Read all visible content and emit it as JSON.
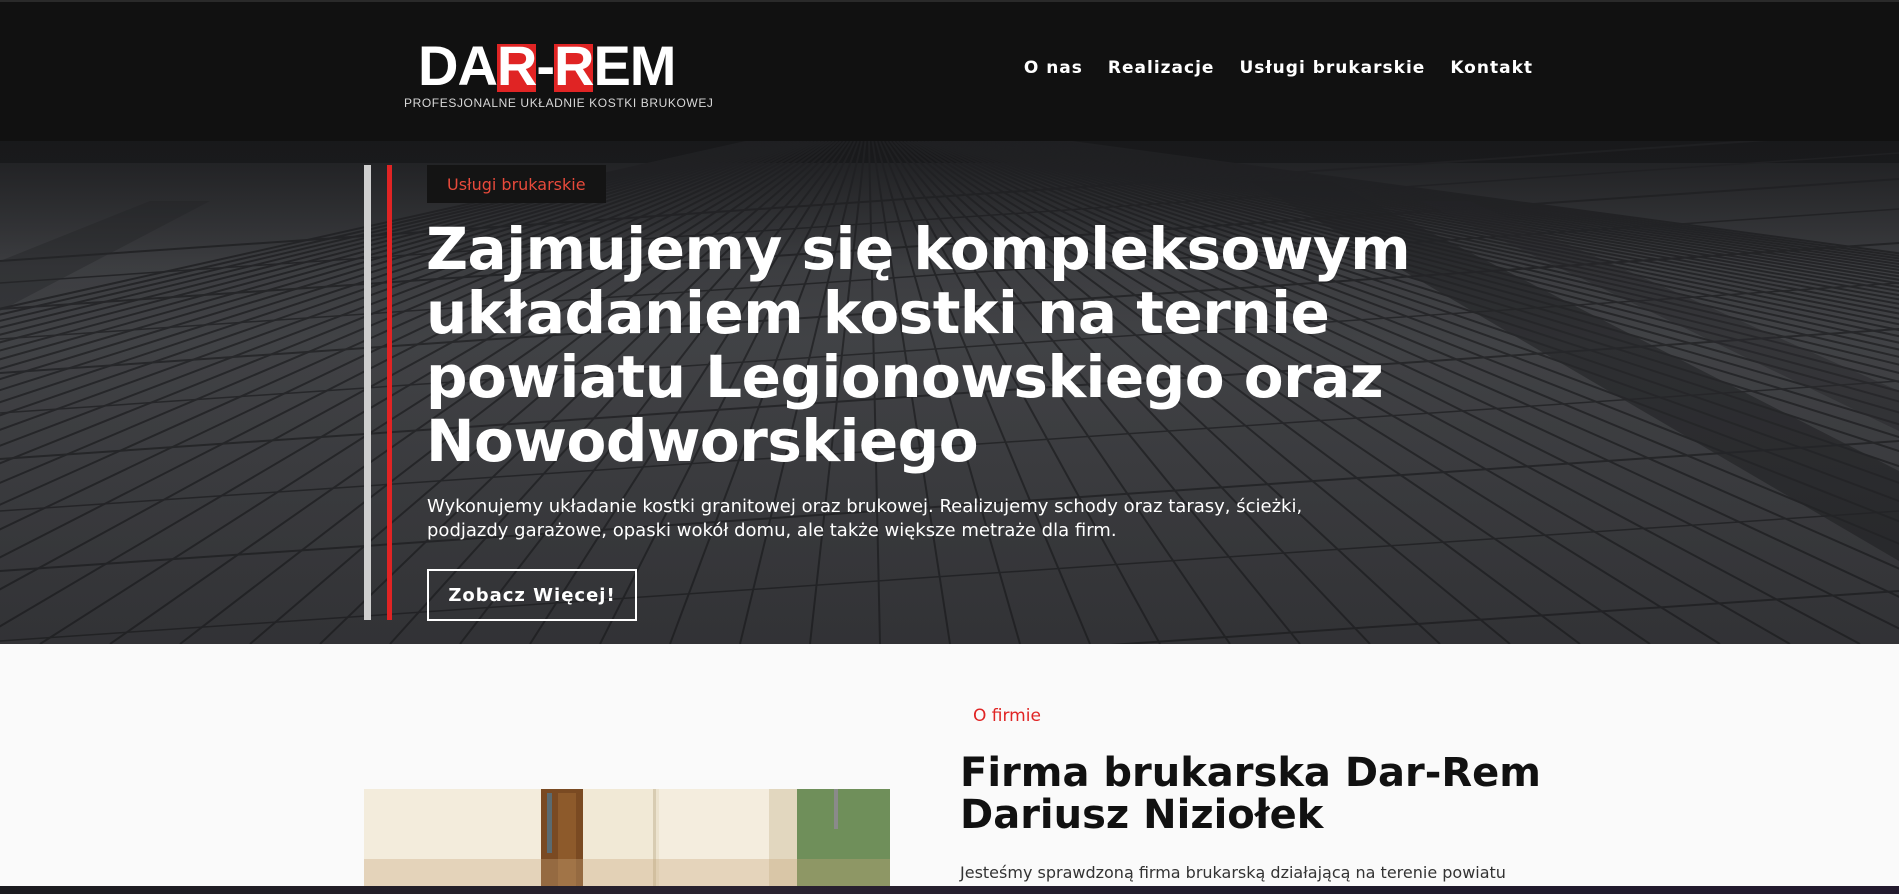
{
  "logo": {
    "part1": "DA",
    "r1": "R",
    "dash": "-",
    "r2": "R",
    "part2": "EM",
    "subtitle": "PROFESJONALNE UKŁADNIE KOSTKI BRUKOWEJ"
  },
  "nav": {
    "items": [
      {
        "label": "O nas"
      },
      {
        "label": "Realizacje"
      },
      {
        "label": "Usługi brukarskie"
      },
      {
        "label": "Kontakt"
      }
    ]
  },
  "hero": {
    "badge": "Usługi brukarskie",
    "title": "Zajmujemy się kompleksowym układaniem kostki na ternie powiatu Legionowskiego oraz Nowodworskiego",
    "text": "Wykonujemy układanie kostki granitowej oraz brukowej. Realizujemy schody oraz tarasy, ścieżki, podjazdy garażowe, opaski wokół domu, ale także większe metraże dla firm.",
    "button": "Zobacz Więcej!"
  },
  "about": {
    "eyebrow": "O firmie",
    "title": "Firma brukarska Dar-Rem Dariusz Niziołek",
    "text": "Jesteśmy sprawdzoną firma brukarską działającą na terenie powiatu"
  },
  "colors": {
    "accent": "#e02424",
    "header_bg": "#111111",
    "page_bg": "#fafafa"
  }
}
